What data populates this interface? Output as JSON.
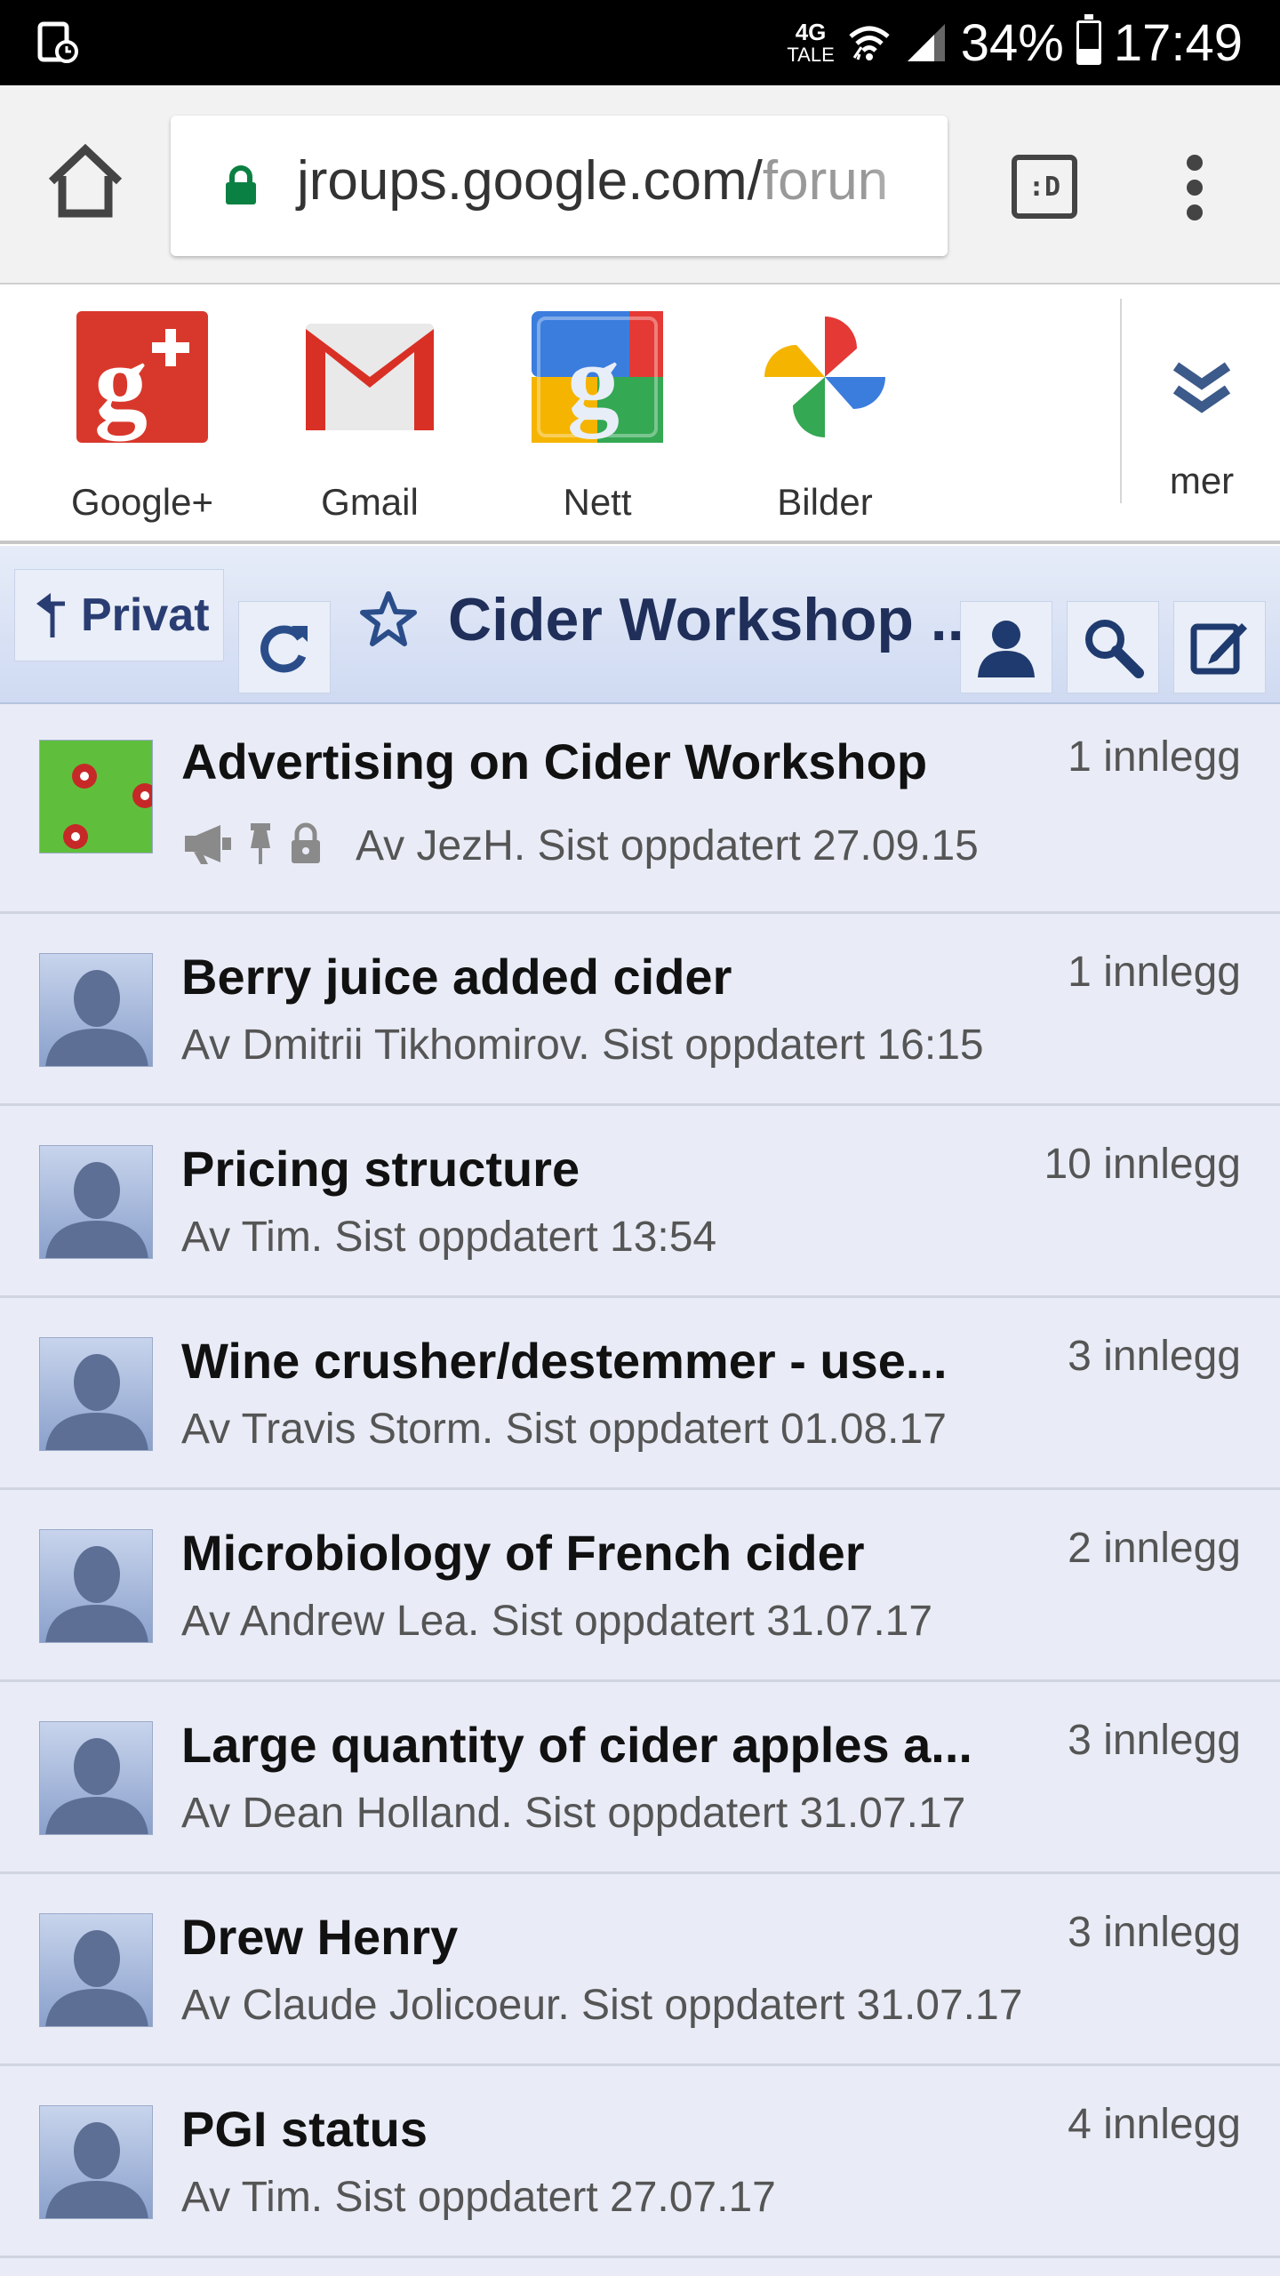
{
  "status_bar": {
    "network": "4G",
    "network_sub": "TALE",
    "battery": "34%",
    "battery_level": 0.34,
    "time": "17:49"
  },
  "browser": {
    "url_main": "jroups.google.com/",
    "url_dim": "forun",
    "ext_button": ":D"
  },
  "apps": [
    {
      "label": "Google+",
      "icon": "google-plus-icon"
    },
    {
      "label": "Gmail",
      "icon": "gmail-icon"
    },
    {
      "label": "Nett",
      "icon": "google-web-icon"
    },
    {
      "label": "Bilder",
      "icon": "photos-pinwheel-icon"
    }
  ],
  "more_label": "mer",
  "group": {
    "back_label": "Privat",
    "title": "Cider Workshop ..."
  },
  "topics": [
    {
      "title": "Advertising on Cider Workshop",
      "sub": "Av JezH. Sist oppdatert 27.09.15",
      "count": "1 innlegg"
    },
    {
      "title": "Berry juice added cider",
      "sub": "Av Dmitrii Tikhomirov. Sist oppdatert 16:15",
      "count": "1 innlegg"
    },
    {
      "title": "Pricing structure",
      "sub": "Av Tim. Sist oppdatert 13:54",
      "count": "10 innlegg"
    },
    {
      "title": "Wine crusher/destemmer - use...",
      "sub": "Av Travis Storm. Sist oppdatert 01.08.17",
      "count": "3 innlegg"
    },
    {
      "title": "Microbiology of French cider",
      "sub": "Av Andrew Lea. Sist oppdatert 31.07.17",
      "count": "2 innlegg"
    },
    {
      "title": "Large quantity of cider apples a...",
      "sub": "Av Dean Holland. Sist oppdatert 31.07.17",
      "count": "3 innlegg"
    },
    {
      "title": "Drew Henry",
      "sub": "Av Claude Jolicoeur. Sist oppdatert 31.07.17",
      "count": "3 innlegg"
    },
    {
      "title": "PGI status",
      "sub": "Av Tim. Sist oppdatert 27.07.17",
      "count": "4 innlegg"
    }
  ]
}
